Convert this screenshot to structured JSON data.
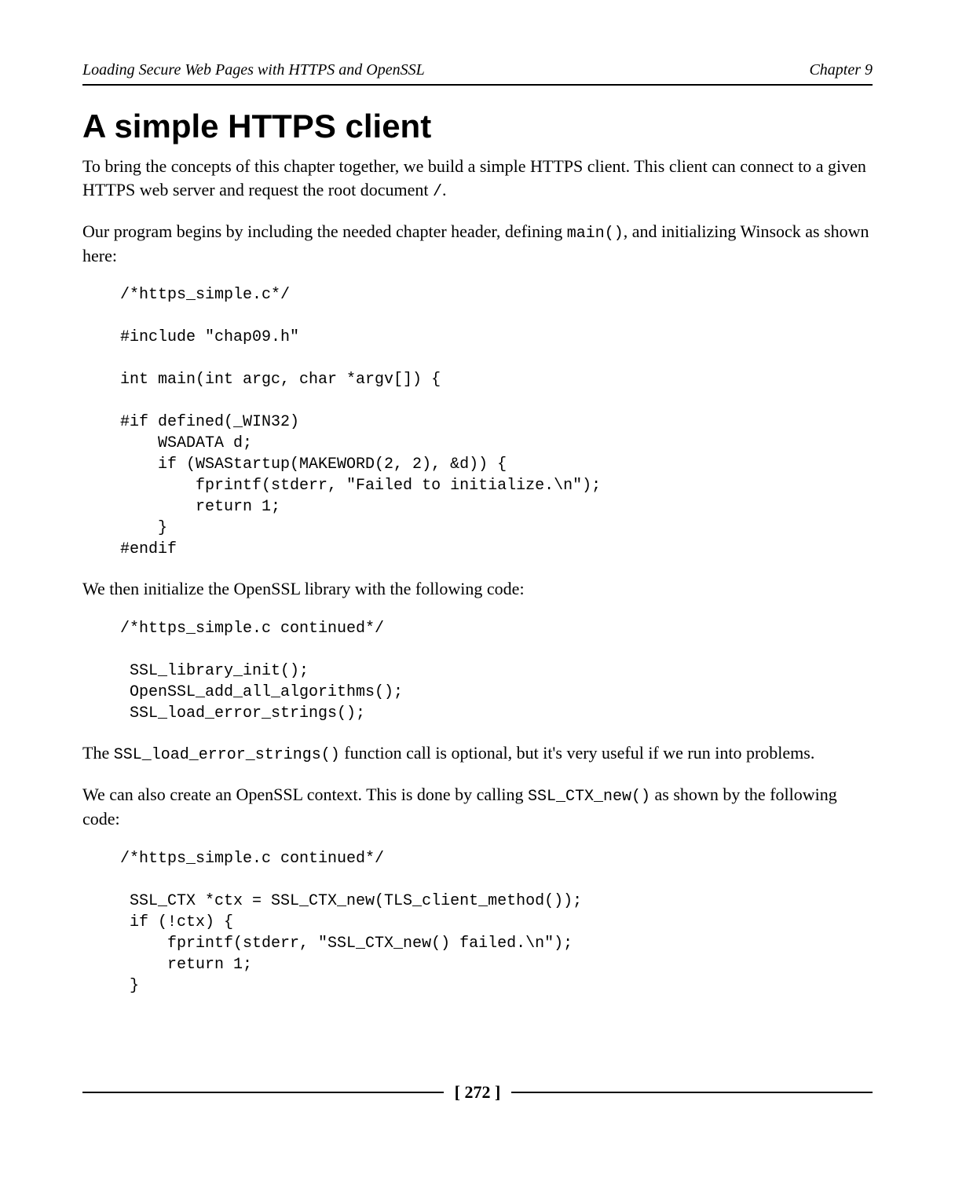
{
  "header": {
    "left": "Loading Secure Web Pages with HTTPS and OpenSSL",
    "right": "Chapter 9"
  },
  "title": "A simple HTTPS client",
  "p1_a": "To bring the concepts of this chapter together, we build a simple HTTPS client. This client can connect to a given HTTPS web server and request the root document ",
  "p1_code": "/",
  "p1_b": ".",
  "p2_a": "Our program begins by including the needed chapter header, defining ",
  "p2_code": "main()",
  "p2_b": ", and initializing Winsock as shown here:",
  "code1": "/*https_simple.c*/\n\n#include \"chap09.h\"\n\nint main(int argc, char *argv[]) {\n\n#if defined(_WIN32)\n    WSADATA d;\n    if (WSAStartup(MAKEWORD(2, 2), &d)) {\n        fprintf(stderr, \"Failed to initialize.\\n\");\n        return 1;\n    }\n#endif",
  "p3": "We then initialize the OpenSSL library with the following code:",
  "code2": "/*https_simple.c continued*/\n\n SSL_library_init();\n OpenSSL_add_all_algorithms();\n SSL_load_error_strings();",
  "p4_a": "The ",
  "p4_code": "SSL_load_error_strings()",
  "p4_b": " function call is optional, but it's very useful if we run into problems.",
  "p5_a": "We can also create an OpenSSL context. This is done by calling ",
  "p5_code": "SSL_CTX_new()",
  "p5_b": " as shown by the following code:",
  "code3": "/*https_simple.c continued*/\n\n SSL_CTX *ctx = SSL_CTX_new(TLS_client_method());\n if (!ctx) {\n     fprintf(stderr, \"SSL_CTX_new() failed.\\n\");\n     return 1;\n }",
  "pagenum": "[ 272 ]"
}
